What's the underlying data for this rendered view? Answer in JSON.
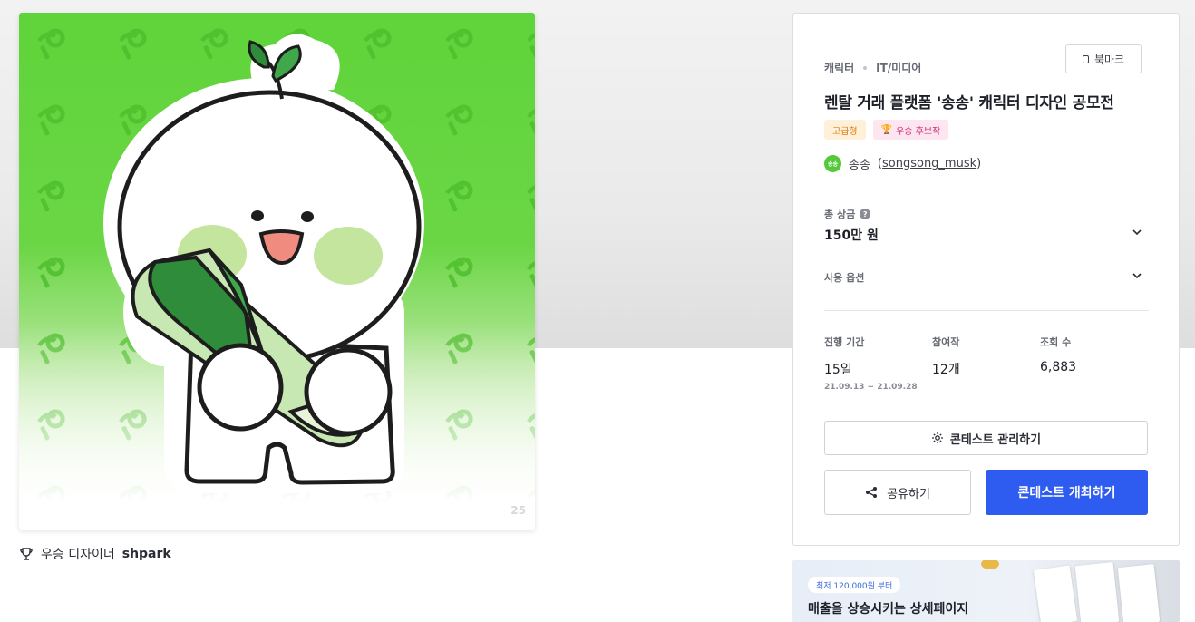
{
  "artwork": {
    "alt_label": "송송 캐릭터 응모작",
    "corner_number": "25",
    "background_color": "#5fd43a"
  },
  "winner": {
    "prefix": "우승 디자이너",
    "name": "shpark"
  },
  "contest": {
    "category": "캐릭터",
    "industry": "IT/미디어",
    "bookmark_label": "북마크",
    "title": "렌탈 거래 플랫폼 '송송' 캐릭터 디자인 공모전",
    "badges": {
      "grade": "고급형",
      "winner": "우승 후보작"
    },
    "host": {
      "avatar_text": "송송",
      "name": "송송",
      "handle": "songsong_musk"
    },
    "prize": {
      "label": "총 상금",
      "help": "?",
      "value": "150만 원"
    },
    "options": {
      "label": "사용 옵션"
    },
    "stats": {
      "period": {
        "label": "진행 기간",
        "value": "15일",
        "range": "21.09.13 ~ 21.09.28"
      },
      "entries": {
        "label": "참여작",
        "value": "12개"
      },
      "views": {
        "label": "조회 수",
        "value": "6,883"
      }
    },
    "manage_label": "콘테스트 관리하기",
    "share_label": "공유하기",
    "host_contest_label": "콘테스트 개최하기"
  },
  "ad": {
    "pill": "최저 120,000원 부터",
    "headline": "매출을 상승시키는 상세페이지"
  },
  "colors": {
    "primary": "#2e5bf0",
    "grade_badge": "#e07b12",
    "winner_badge": "#d12b74"
  }
}
